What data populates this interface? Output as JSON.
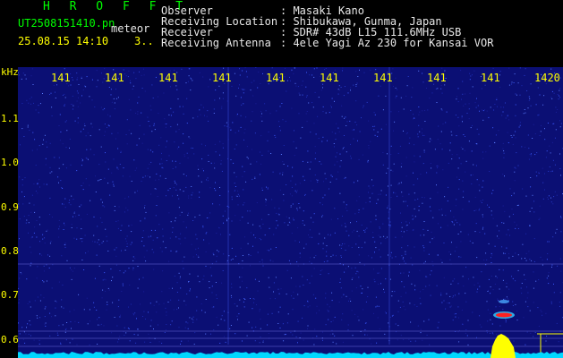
{
  "header": {
    "brand": "H R O F F T",
    "filename": "UT2508151410.pn",
    "meteor": "meteor",
    "datetime": "25.08.15 14:10    3..",
    "fields": [
      {
        "key": "Observer",
        "value": ": Masaki Kano"
      },
      {
        "key": "Receiving Location",
        "value": ": Shibukawa, Gunma, Japan"
      },
      {
        "key": "Receiver",
        "value": ": SDR# 43dB L15 111.6MHz USB"
      },
      {
        "key": "Receiving Antenna",
        "value": ": 4ele Yagi Az 230 for Kansai VOR"
      }
    ]
  },
  "axis": {
    "unit": "kHz",
    "y_labels": [
      "1.1",
      "1.0",
      "0.9",
      "0.8",
      "0.7",
      "0.6"
    ],
    "x_labels": [
      "141",
      "141",
      "141",
      "141",
      "141",
      "141",
      "141",
      "141",
      "141",
      "1420"
    ]
  },
  "colors": {
    "background": "#0b0f74",
    "label": "#ffff00",
    "header_green": "#00ff00",
    "echo": "#ff2020",
    "noise_floor": "#00ffff"
  }
}
